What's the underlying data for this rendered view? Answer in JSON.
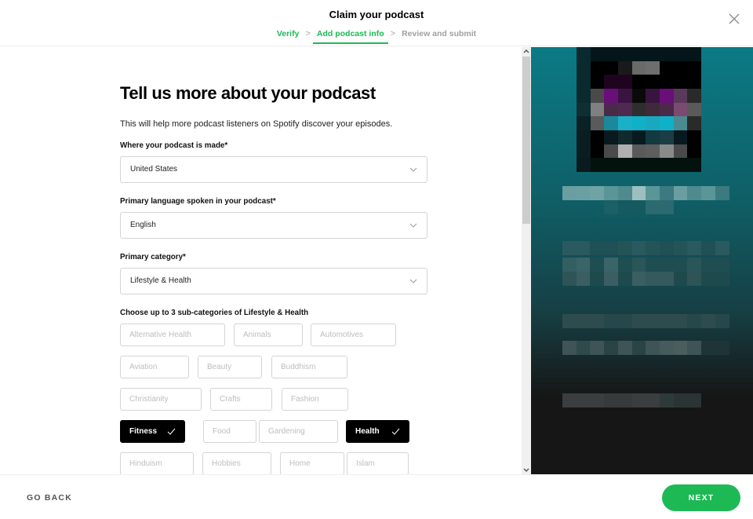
{
  "header": {
    "title": "Claim your podcast",
    "steps": [
      {
        "label": "Verify",
        "state": "done"
      },
      {
        "label": "Add podcast info",
        "state": "active"
      },
      {
        "label": "Review and submit",
        "state": "pending"
      }
    ],
    "step_separator": ">",
    "close_icon": "close-icon"
  },
  "form": {
    "title": "Tell us more about your podcast",
    "subtitle": "This will help more podcast listeners on Spotify discover your episodes.",
    "fields": [
      {
        "label": "Where your podcast is made*",
        "value": "United States"
      },
      {
        "label": "Primary language spoken in your podcast*",
        "value": "English"
      },
      {
        "label": "Primary category*",
        "value": "Lifestyle & Health"
      }
    ],
    "subcategories": {
      "label": "Choose up to 3 sub-categories of Lifestyle & Health",
      "items": [
        {
          "label": "Alternative Health",
          "selected": false
        },
        {
          "label": "Animals",
          "selected": false
        },
        {
          "label": "Automotives",
          "selected": false
        },
        {
          "label": "Aviation",
          "selected": false
        },
        {
          "label": "Beauty",
          "selected": false
        },
        {
          "label": "Buddhism",
          "selected": false
        },
        {
          "label": "Christianity",
          "selected": false
        },
        {
          "label": "Crafts",
          "selected": false
        },
        {
          "label": "Fashion",
          "selected": false
        },
        {
          "label": "Fitness",
          "selected": true
        },
        {
          "label": "Food",
          "selected": false
        },
        {
          "label": "Gardening",
          "selected": false
        },
        {
          "label": "Health",
          "selected": true
        },
        {
          "label": "Hinduism",
          "selected": false
        },
        {
          "label": "Hobbies",
          "selected": false
        },
        {
          "label": "Home",
          "selected": false
        },
        {
          "label": "Islam",
          "selected": false
        }
      ]
    }
  },
  "preview": {
    "description": "Pixelated podcast cover art preview",
    "accent_color": "#0b7a85"
  },
  "footer": {
    "back_label": "GO BACK",
    "next_label": "NEXT"
  },
  "colors": {
    "brand_green": "#1db954",
    "selected_chip": "#000000",
    "muted_text": "#a0a0a0"
  }
}
